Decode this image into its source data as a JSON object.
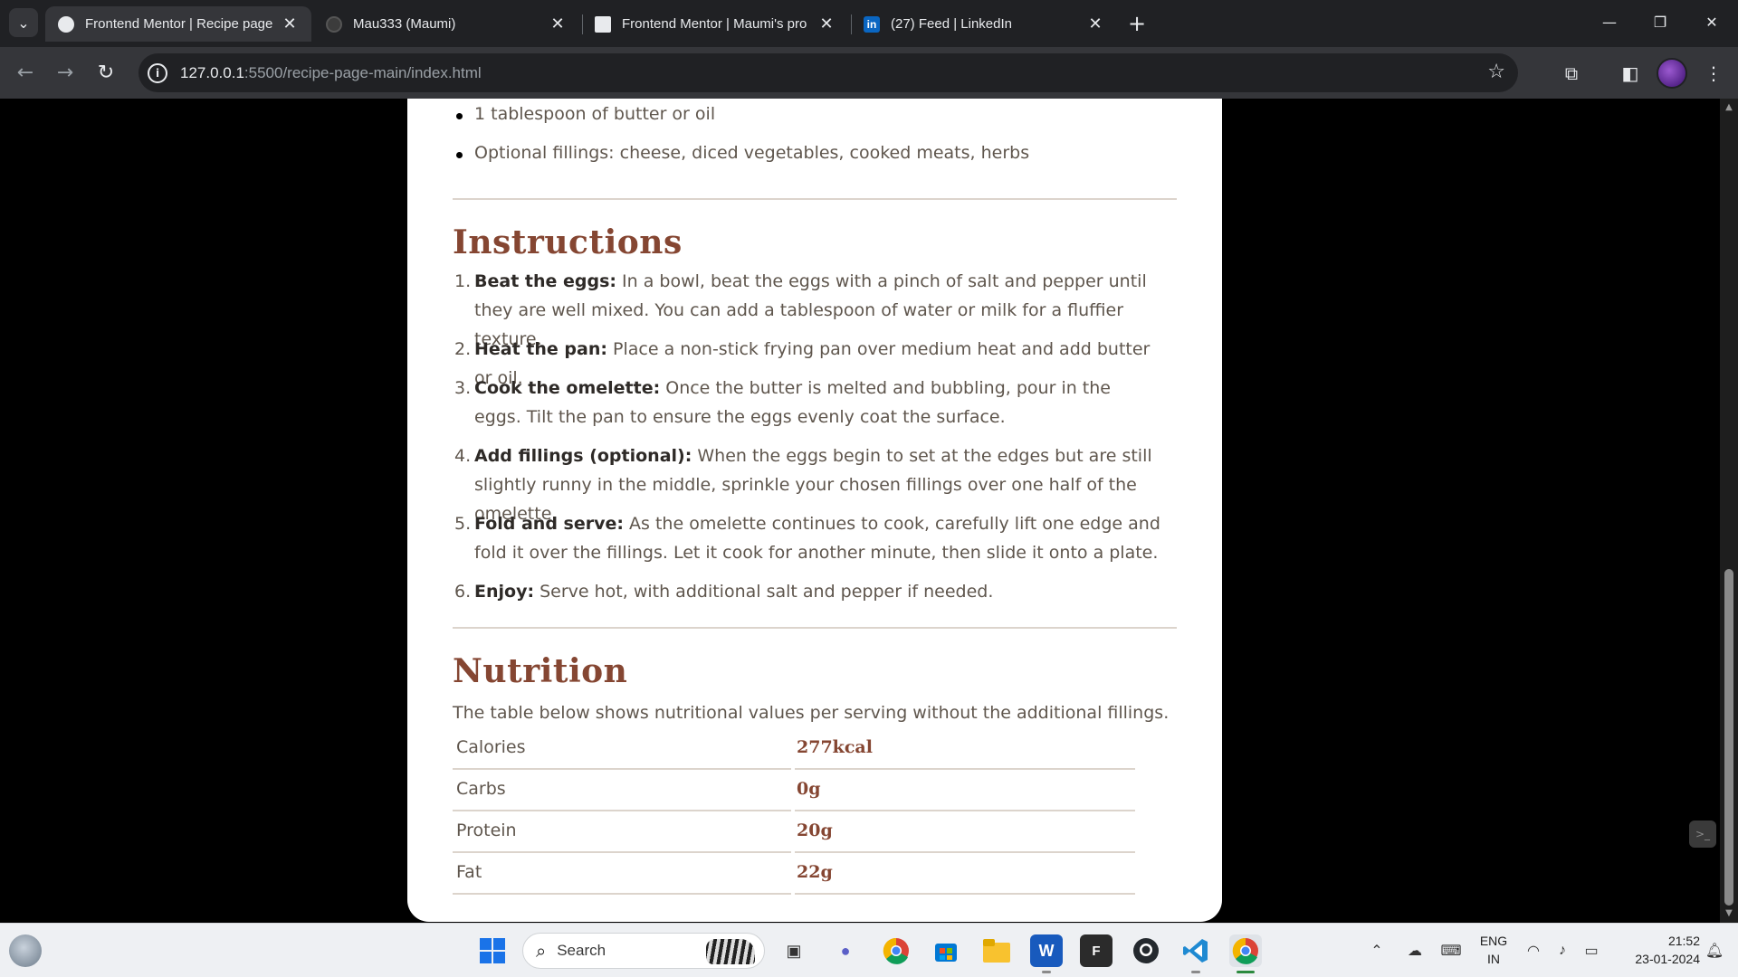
{
  "browser": {
    "tabs": [
      {
        "title": "Frontend Mentor | Recipe page",
        "active": true
      },
      {
        "title": "Mau333 (Maumi)",
        "active": false
      },
      {
        "title": "Frontend Mentor | Maumi's pro",
        "active": false
      },
      {
        "title": "(27) Feed | LinkedIn",
        "active": false
      }
    ],
    "url_host": "127.0.0.1",
    "url_path": ":5500/recipe-page-main/index.html",
    "linkedin_badge": "in"
  },
  "page": {
    "ingredients_tail": [
      "1 tablespoon of butter or oil",
      "Optional fillings: cheese, diced vegetables, cooked meats, herbs"
    ],
    "instructions_heading": "Instructions",
    "instructions": [
      {
        "num": "1.",
        "bold": "Beat the eggs:",
        "text": " In a bowl, beat the eggs with a pinch of salt and pepper until they are well mixed. You can add a tablespoon of water or milk for a fluffier texture."
      },
      {
        "num": "2.",
        "bold": "Heat the pan:",
        "text": " Place a non-stick frying pan over medium heat and add butter or oil."
      },
      {
        "num": "3.",
        "bold": "Cook the omelette:",
        "text": " Once the butter is melted and bubbling, pour in the eggs. Tilt the pan to ensure the eggs evenly coat the surface."
      },
      {
        "num": "4.",
        "bold": "Add fillings (optional):",
        "text": " When the eggs begin to set at the edges but are still slightly runny in the middle, sprinkle your chosen fillings over one half of the omelette."
      },
      {
        "num": "5.",
        "bold": "Fold and serve:",
        "text": " As the omelette continues to cook, carefully lift one edge and fold it over the fillings. Let it cook for another minute, then slide it onto a plate."
      },
      {
        "num": "6.",
        "bold": "Enjoy:",
        "text": " Serve hot, with additional salt and pepper if needed."
      }
    ],
    "nutrition_heading": "Nutrition",
    "nutrition_intro": "The table below shows nutritional values per serving without the additional fillings.",
    "nutrition": [
      {
        "label": "Calories",
        "value": "277kcal"
      },
      {
        "label": "Carbs",
        "value": "0g"
      },
      {
        "label": "Protein",
        "value": "20g"
      },
      {
        "label": "Fat",
        "value": "22g"
      }
    ]
  },
  "taskbar": {
    "search_label": "Search",
    "language": "ENG",
    "region": "IN",
    "time": "21:52",
    "date": "23-01-2024",
    "word_glyph": "W",
    "f_glyph": "F"
  },
  "colors": {
    "heading": "#854632",
    "body_text": "#5f564d",
    "divider": "#dcd4cc",
    "chrome_dark": "#202124",
    "chrome_mid": "#35363a"
  }
}
